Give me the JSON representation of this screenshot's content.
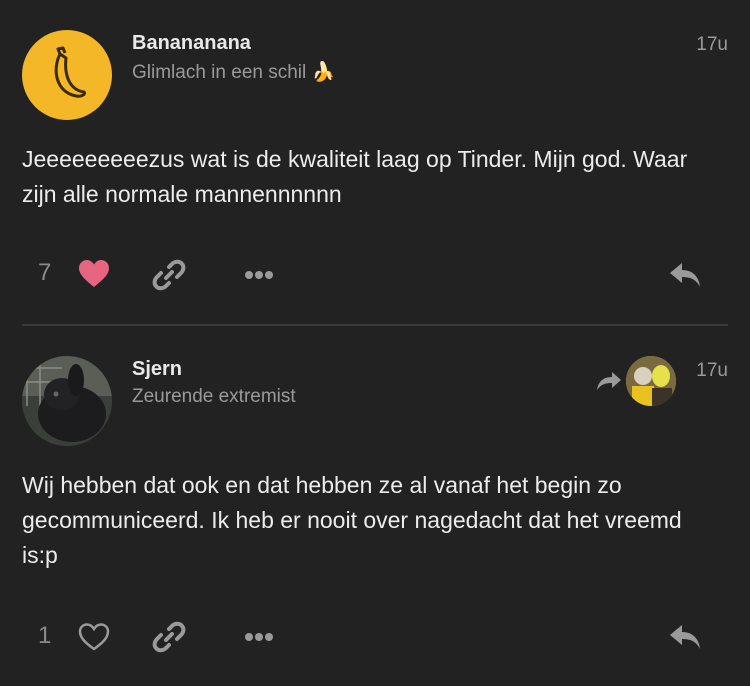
{
  "posts": [
    {
      "username": "Banananana",
      "user_title": "Glimlach in een schil 🍌",
      "time": "17u",
      "body": "Jeeeeeeeeezus wat is de kwaliteit laag op Tinder. Mijn god. Waar zijn alle normale mannennnnnn",
      "likes": "7",
      "liked": true,
      "avatar_icon": "banana-icon"
    },
    {
      "username": "Sjern",
      "user_title": "Zeurende extremist",
      "time": "17u",
      "body": "Wij hebben dat ook en dat hebben ze al vanaf het begin zo gecommuniceerd. Ik heb er nooit over nagedacht dat het vreemd is:p",
      "likes": "1",
      "liked": false,
      "avatar_icon": "rabbit-photo"
    }
  ],
  "colors": {
    "background": "#222222",
    "like_active": "#e8657f",
    "muted": "#9a9a9a",
    "banana_avatar": "#f3b728"
  }
}
